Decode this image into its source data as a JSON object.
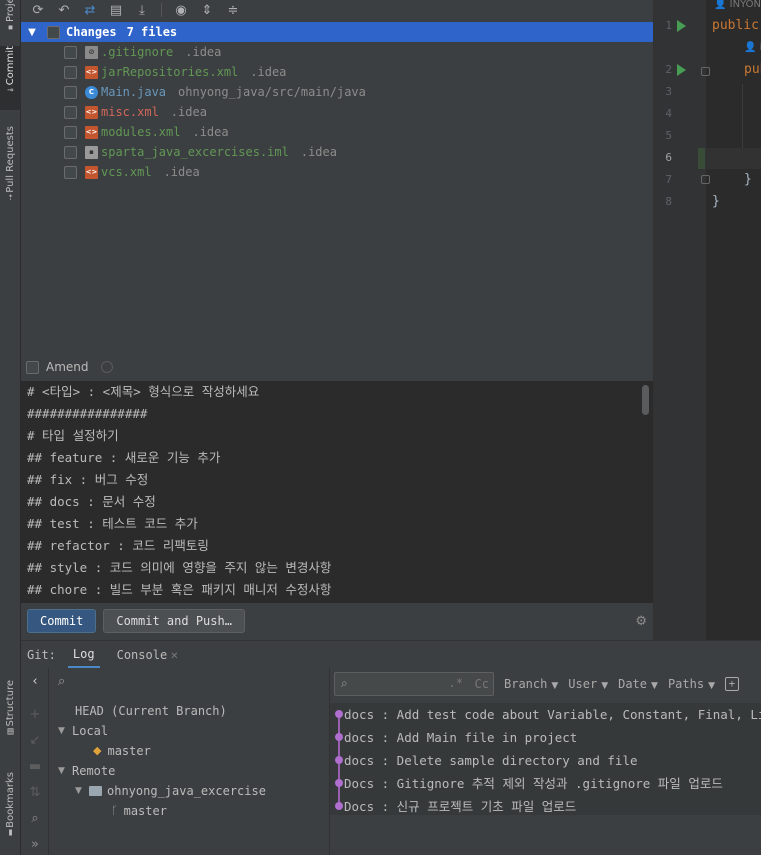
{
  "left_strip": {
    "tabs": [
      {
        "label": "Project"
      },
      {
        "label": "Commit"
      },
      {
        "label": "Pull Requests"
      },
      {
        "label": "Structure"
      },
      {
        "label": "Bookmarks"
      }
    ]
  },
  "changes": {
    "group_label": "Changes",
    "count_label": "7 files",
    "files": [
      {
        "name": ".gitignore",
        "path": ".idea",
        "icon": "gitignore-file-icon"
      },
      {
        "name": "jarRepositories.xml",
        "path": ".idea",
        "icon": "xml-file-icon"
      },
      {
        "name": "Main.java",
        "path": "ohnyong_java/src/main/java",
        "icon": "java-class-icon"
      },
      {
        "name": "misc.xml",
        "path": ".idea",
        "icon": "xml-file-icon"
      },
      {
        "name": "modules.xml",
        "path": ".idea",
        "icon": "xml-file-icon"
      },
      {
        "name": "sparta_java_excercises.iml",
        "path": ".idea",
        "icon": "iml-file-icon"
      },
      {
        "name": "vcs.xml",
        "path": ".idea",
        "icon": "xml-file-icon"
      }
    ]
  },
  "amend": {
    "label": "Amend"
  },
  "commit_message": {
    "lines": [
      "# <타입> : <제목> 형식으로 작성하세요",
      "################",
      "# 타입 설정하기",
      "## feature : 새로운 기능 추가",
      "## fix : 버그 수정",
      "## docs : 문서 수정",
      "## test : 테스트 코드 추가",
      "## refactor : 코드 리팩토링",
      "## style : 코드 의미에 영향을 주지 않는 변경사항",
      "## chore : 빌드 부분 혹은 패키지 매니저 수정사항"
    ]
  },
  "buttons": {
    "commit": "Commit",
    "commit_and_push": "Commit and Push…"
  },
  "editor": {
    "line_numbers": [
      "1",
      "2",
      "3",
      "4",
      "5",
      "6",
      "7",
      "8"
    ],
    "hint_top": "INYONG",
    "hint_line2": "i",
    "code_line1": "public",
    "code_line2": "pub",
    "code_line7": "}",
    "code_line8": "}"
  },
  "git": {
    "label": "Git:",
    "tabs": [
      {
        "label": "Log"
      },
      {
        "label": "Console"
      }
    ],
    "branches": {
      "head": "HEAD (Current Branch)",
      "local": "Local",
      "local_master": "master",
      "remote": "Remote",
      "remote_repo": "ohnyong_java_excercise",
      "remote_master": "master"
    },
    "filters": [
      "Branch",
      "User",
      "Date",
      "Paths"
    ],
    "search": {
      "regex": ".*",
      "case": "Cc"
    },
    "commits": [
      "docs : Add test code about Variable, Constant, Final, Literal",
      "docs : Add Main file in project",
      "docs : Delete sample directory and file",
      "Docs : Gitignore 추적 제외 작성과 .gitignore 파일 업로드",
      "Docs : 신규 프로젝트 기초 파일 업로드"
    ]
  }
}
